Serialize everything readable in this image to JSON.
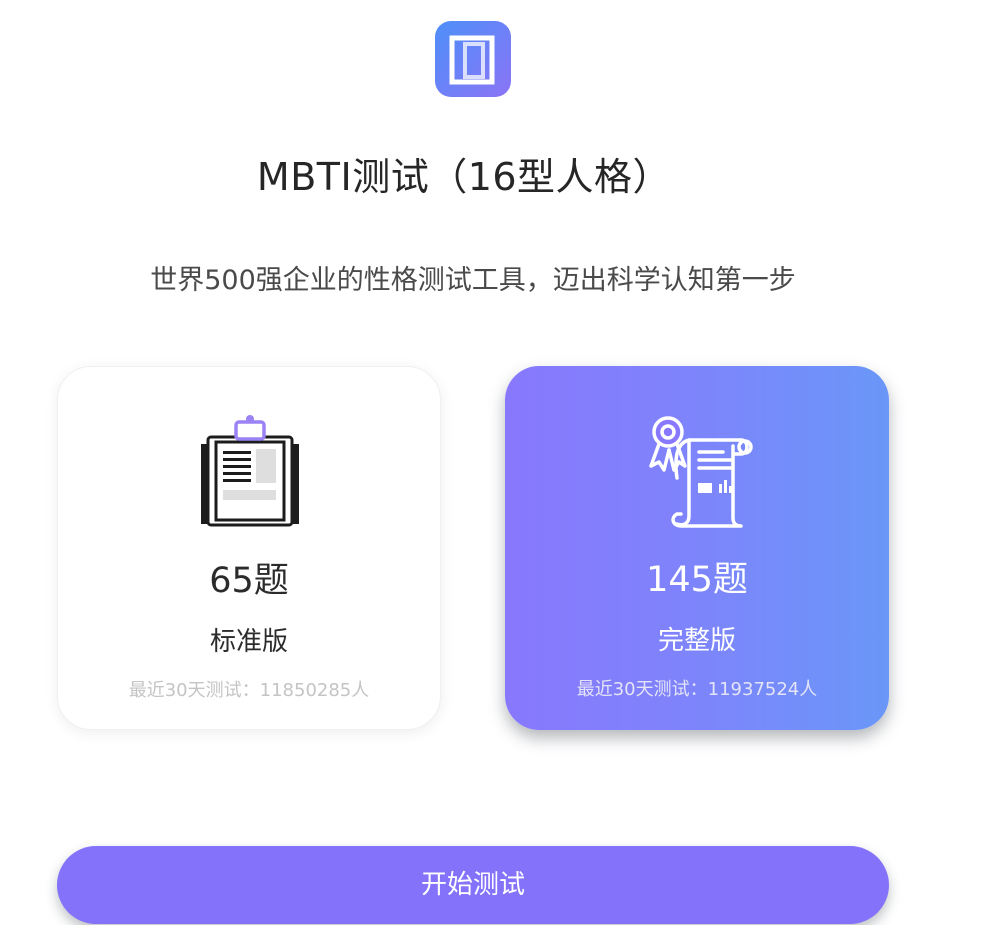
{
  "header": {
    "logo_icon": "book-frame-icon",
    "title": "MBTI测试（16型人格）",
    "subtitle": "世界500强企业的性格测试工具，迈出科学认知第一步"
  },
  "cards": [
    {
      "icon": "clipboard-icon",
      "count": "65题",
      "edition": "标准版",
      "stats": "最近30天测试：11850285人",
      "selected": false
    },
    {
      "icon": "certificate-scroll-icon",
      "count": "145题",
      "edition": "完整版",
      "stats": "最近30天测试：11937524人",
      "selected": true
    }
  ],
  "start_button": {
    "label": "开始测试"
  },
  "colors": {
    "accent": "#8472fa",
    "gradient_start": "#8878fd",
    "gradient_end": "#6a97f8"
  }
}
